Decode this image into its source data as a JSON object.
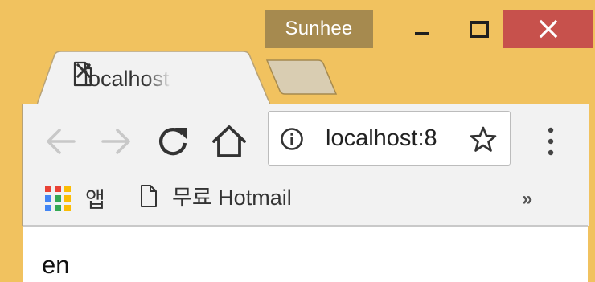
{
  "window": {
    "profile_name": "Sunhee",
    "controls": {
      "minimize_icon": "minimize-icon",
      "maximize_icon": "maximize-icon",
      "close_icon": "close-icon"
    }
  },
  "tabs": [
    {
      "title": "localhost",
      "icon": "page-icon",
      "active": true
    }
  ],
  "toolbar": {
    "back_icon": "back-arrow-icon",
    "forward_icon": "forward-arrow-icon",
    "reload_icon": "reload-icon",
    "home_icon": "home-icon",
    "address": "localhost:8",
    "info_icon": "info-icon",
    "star_icon": "star-icon",
    "menu_icon": "kebab-menu-icon"
  },
  "bookmarks": {
    "apps_label": "앱",
    "items": [
      {
        "label": "무료 Hotmail",
        "icon": "page-icon"
      }
    ],
    "overflow_label": "»"
  },
  "page": {
    "content_text": "en"
  },
  "colors": {
    "frame": "#f1c25f",
    "profile_badge": "#a68a4f",
    "close_button": "#c7514c",
    "toolbar": "#f2f2f2"
  }
}
